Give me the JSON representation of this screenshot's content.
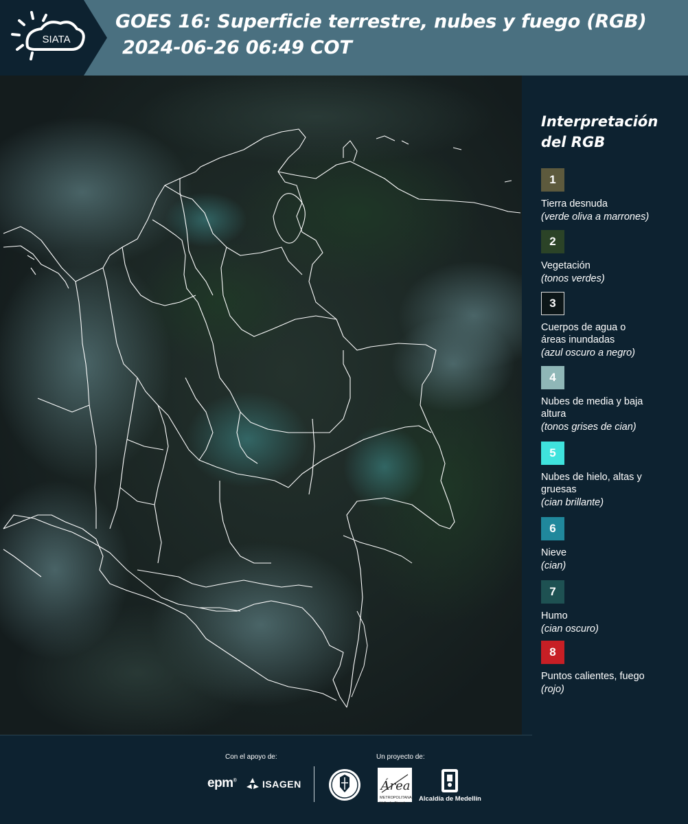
{
  "header": {
    "logo_text": "SIATA",
    "title_line1": "GOES 16: Superficie terrestre, nubes y fuego (RGB)",
    "title_line2": "2024-06-26 06:49 COT"
  },
  "legend": {
    "title": "Interpretación del RGB",
    "items": [
      {
        "number": "1",
        "label": "Tierra desnuda",
        "sub": "(verde oliva a marrones)",
        "color": "#5d5a3d"
      },
      {
        "number": "2",
        "label": "Vegetación",
        "sub": "(tonos verdes)",
        "color": "#2b4327"
      },
      {
        "number": "3",
        "label": "Cuerpos de agua o áreas inundadas",
        "sub": "(azul oscuro a negro)",
        "color": "#0c1618"
      },
      {
        "number": "4",
        "label": "Nubes de media y baja altura",
        "sub": "(tonos grises de cian)",
        "color": "#8fb7b7"
      },
      {
        "number": "5",
        "label": "Nubes de hielo, altas y gruesas",
        "sub": "(cian brillante)",
        "color": "#3fe3dd"
      },
      {
        "number": "6",
        "label": "Nieve",
        "sub": "(cian)",
        "color": "#20889c"
      },
      {
        "number": "7",
        "label": "Humo",
        "sub": "(cian oscuro)",
        "color": "#1e5152"
      },
      {
        "number": "8",
        "label": "Puntos calientes, fuego",
        "sub": "(rojo)",
        "color": "#c71f25"
      }
    ]
  },
  "footer": {
    "support_label": "Con el apoyo de:",
    "project_label": "Un proyecto de:",
    "epm": "epm",
    "isagen": "ISAGEN",
    "area_logo_text": "Área",
    "area_caption": "METROPOLITANA Valle de Aburrá",
    "alcaldia": "Alcaldía de Medellín"
  },
  "colors": {
    "header_bg": "#4a7080",
    "panel_bg": "#0d2230",
    "map_bg": "#0f1a1c",
    "border_lines": "#ffffff"
  }
}
